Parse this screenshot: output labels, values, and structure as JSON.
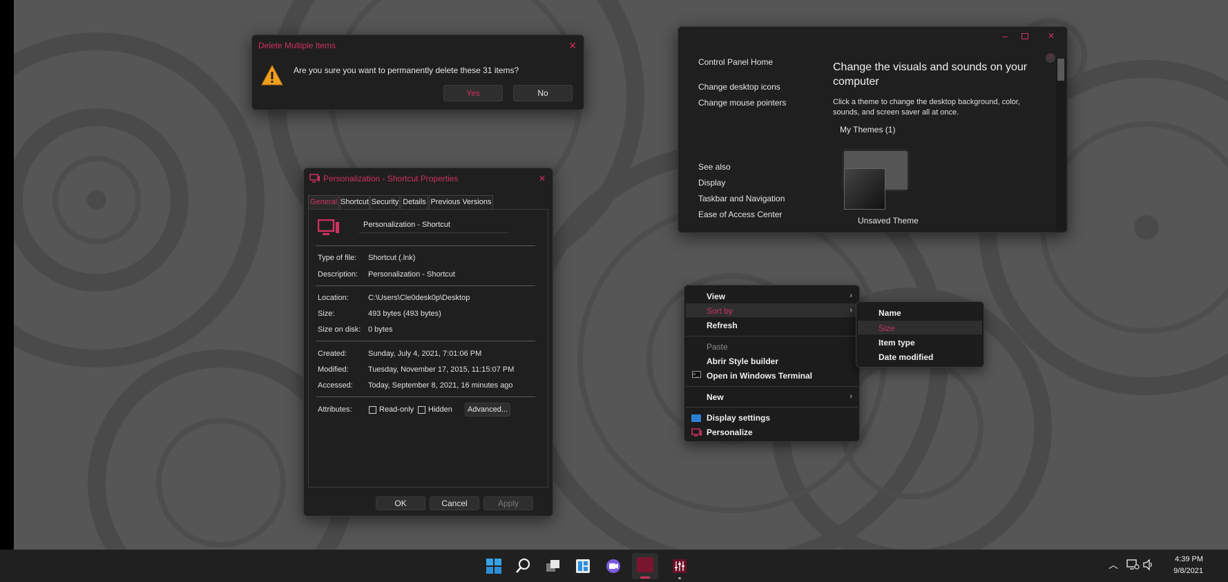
{
  "delete_dialog": {
    "title": "Delete Multiple Items",
    "message": "Are you sure you want to permanently delete these 31 items?",
    "yes_label": "Yes",
    "no_label": "No"
  },
  "properties": {
    "title": "Personalization - Shortcut Properties",
    "tabs": [
      "General",
      "Shortcut",
      "Security",
      "Details",
      "Previous Versions"
    ],
    "name_value": "Personalization - Shortcut",
    "rows": {
      "type_label": "Type of file:",
      "type_value": "Shortcut (.lnk)",
      "desc_label": "Description:",
      "desc_value": "Personalization - Shortcut",
      "location_label": "Location:",
      "location_value": "C:\\Users\\Cle0desk0p\\Desktop",
      "size_label": "Size:",
      "size_value": "493 bytes (493 bytes)",
      "sizedisk_label": "Size on disk:",
      "sizedisk_value": "0 bytes",
      "created_label": "Created:",
      "created_value": "Sunday, July 4, 2021, 7:01:06 PM",
      "modified_label": "Modified:",
      "modified_value": "Tuesday, November 17, 2015, 11:15:07 PM",
      "accessed_label": "Accessed:",
      "accessed_value": "Today, September 8, 2021, 16 minutes ago",
      "attributes_label": "Attributes:"
    },
    "readonly_label": "Read-only",
    "hidden_label": "Hidden",
    "advanced_label": "Advanced...",
    "ok_label": "OK",
    "cancel_label": "Cancel",
    "apply_label": "Apply"
  },
  "control_panel": {
    "nav_home": "Control Panel Home",
    "nav_links": [
      "Change desktop icons",
      "Change mouse pointers"
    ],
    "see_also_label": "See also",
    "see_also_links": [
      "Display",
      "Taskbar and Navigation",
      "Ease of Access Center"
    ],
    "heading": "Change the visuals and sounds on your computer",
    "description": "Click a theme to change the desktop background, color, sounds, and screen saver all at once.",
    "my_themes": "My Themes (1)",
    "theme_name": "Unsaved Theme",
    "help_glyph": "?"
  },
  "context_menu": {
    "view": "View",
    "sort_by": "Sort by",
    "refresh": "Refresh",
    "paste": "Paste",
    "abrir": "Abrir Style builder",
    "terminal": "Open in Windows Terminal",
    "new": "New",
    "display_settings": "Display settings",
    "personalize": "Personalize"
  },
  "sort_submenu": {
    "items": [
      "Name",
      "Size",
      "Item type",
      "Date modified"
    ]
  },
  "taskbar": {
    "time": "4:39 PM",
    "date": "9/8/2021"
  },
  "colors": {
    "accent": "#d0325f",
    "desktop": "#565656",
    "window_bg": "#1f1f1f"
  }
}
